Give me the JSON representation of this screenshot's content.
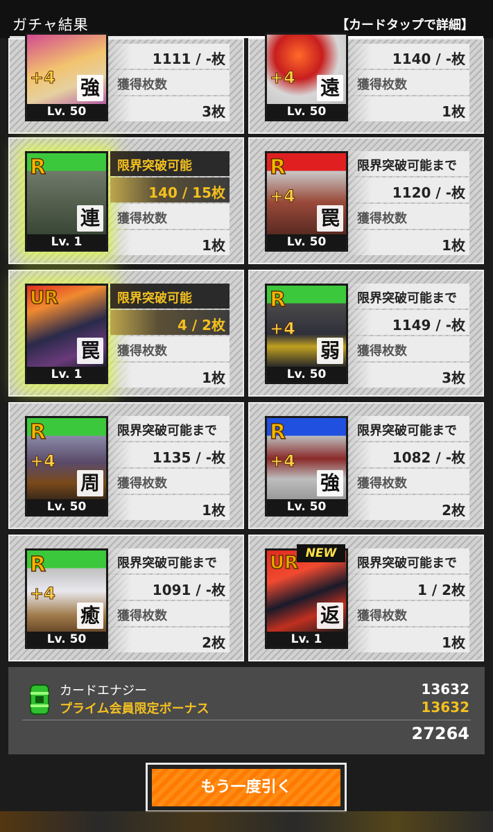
{
  "header": {
    "title": "ガチャ結果",
    "hint": "【カードタップで詳細】"
  },
  "labels": {
    "limit_break_possible": "限界突破可能",
    "until_limit_break": "限界突破可能まで",
    "acquired_count": "獲得枚数"
  },
  "cards": [
    {
      "rank": "",
      "plus": "+4",
      "kanji": "強",
      "level": "Lv. 50",
      "status": "",
      "progress": "1111 / -枚",
      "count": "3枚"
    },
    {
      "rank": "",
      "plus": "+4",
      "kanji": "遠",
      "level": "Lv. 50",
      "status": "",
      "progress": "1140 / -枚",
      "count": "1枚"
    },
    {
      "rank": "R",
      "plus": "",
      "kanji": "連",
      "level": "Lv. 1",
      "status": "限界突破可能",
      "progress": "140 / 15枚",
      "count": "1枚"
    },
    {
      "rank": "R",
      "plus": "+4",
      "kanji": "罠",
      "level": "Lv. 50",
      "status": "限界突破可能まで",
      "progress": "1120 / -枚",
      "count": "1枚"
    },
    {
      "rank": "UR",
      "plus": "",
      "kanji": "罠",
      "level": "Lv. 1",
      "status": "限界突破可能",
      "progress": "4 / 2枚",
      "count": "1枚"
    },
    {
      "rank": "R",
      "plus": "+4",
      "kanji": "弱",
      "level": "Lv. 50",
      "status": "限界突破可能まで",
      "progress": "1149 / -枚",
      "count": "3枚"
    },
    {
      "rank": "R",
      "plus": "+4",
      "kanji": "周",
      "level": "Lv. 50",
      "status": "限界突破可能まで",
      "progress": "1135 / -枚",
      "count": "1枚"
    },
    {
      "rank": "R",
      "plus": "+4",
      "kanji": "強",
      "level": "Lv. 50",
      "status": "限界突破可能まで",
      "progress": "1082 / -枚",
      "count": "2枚"
    },
    {
      "rank": "R",
      "plus": "+4",
      "kanji": "癒",
      "level": "Lv. 50",
      "status": "限界突破可能まで",
      "progress": "1091 / -枚",
      "count": "2枚"
    },
    {
      "rank": "UR",
      "plus": "",
      "kanji": "返",
      "level": "Lv. 1",
      "status": "限界突破可能まで",
      "progress": "1 / 2枚",
      "count": "1枚",
      "badge": "NEW"
    }
  ],
  "energy": {
    "label": "カードエナジー",
    "value": "13632",
    "bonus_label": "プライム会員限定ボーナス",
    "bonus_value": "13632",
    "total": "27264",
    "icon": "energy-canister-icon"
  },
  "again_button": "もう一度引く",
  "colors": {
    "accent_gold": "#f4c020",
    "button_orange": "#ff7a00",
    "glow": "#e2ff3c",
    "rank_R_green": "#3cc83c",
    "rank_R_red": "#e02020",
    "rank_R_blue": "#2050e0"
  }
}
